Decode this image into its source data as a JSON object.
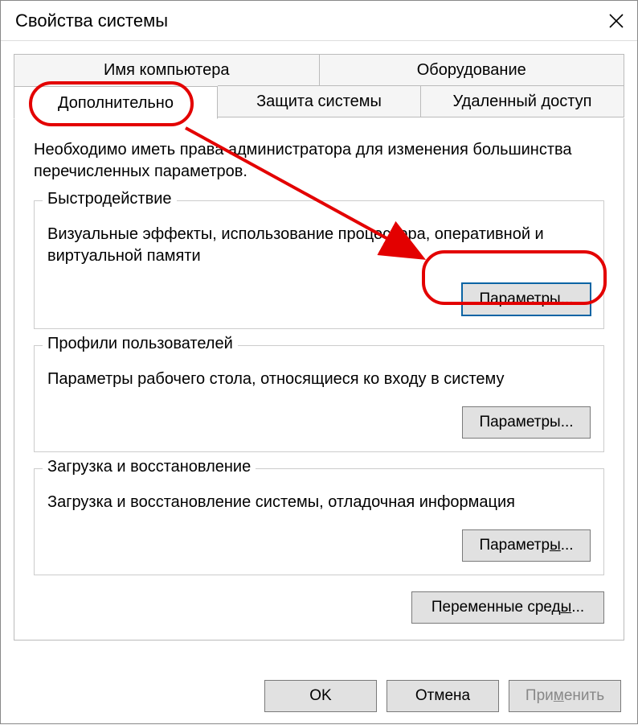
{
  "window": {
    "title": "Свойства системы"
  },
  "tabs": {
    "row1": [
      {
        "label": "Имя компьютера"
      },
      {
        "label": "Оборудование"
      }
    ],
    "row2": [
      {
        "label": "Дополнительно",
        "active": true
      },
      {
        "label": "Защита системы"
      },
      {
        "label": "Удаленный доступ"
      }
    ]
  },
  "content": {
    "help_text": "Необходимо иметь права администратора для изменения большинства перечисленных параметров.",
    "groups": {
      "performance": {
        "legend": "Быстродействие",
        "desc": "Визуальные эффекты, использование процессора, оперативной и виртуальной памяти",
        "button_prefix": "П",
        "button_suffix": "араметры..."
      },
      "profiles": {
        "legend": "Профили пользователей",
        "desc": "Параметры рабочего стола, относящиеся ко входу в систему",
        "button": "Параметры..."
      },
      "startup": {
        "legend": "Загрузка и восстановление",
        "desc": "Загрузка и восстановление системы, отладочная информация",
        "button_prefix": "Параметр",
        "button_mnemonic": "ы",
        "button_suffix": "..."
      }
    },
    "env_button_prefix": "Переменные сред",
    "env_button_mnemonic": "ы",
    "env_button_suffix": "..."
  },
  "footer": {
    "ok": "OK",
    "cancel": "Отмена",
    "apply_prefix": "При",
    "apply_mnemonic": "м",
    "apply_suffix": "енить"
  }
}
